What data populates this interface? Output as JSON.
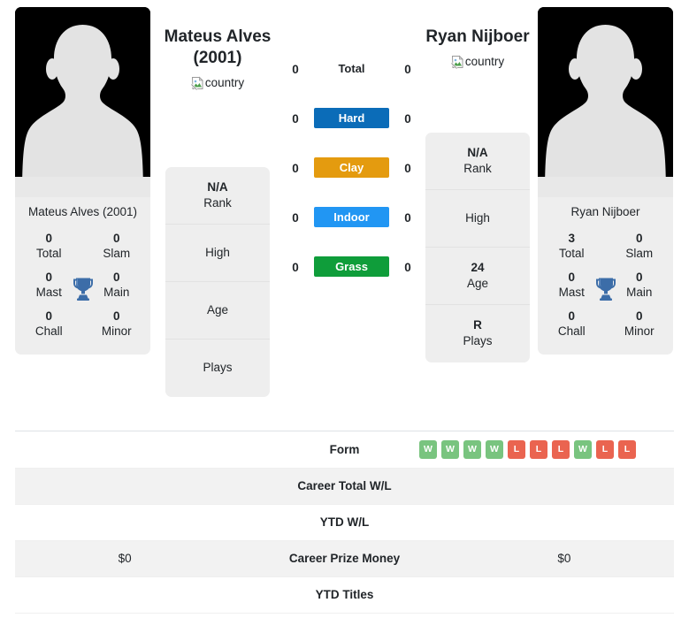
{
  "players": {
    "left": {
      "heading": "Mateus Alves (2001)",
      "card_name": "Mateus Alves (2001)",
      "country_alt": "country",
      "photo_alt": "player-photo",
      "titles": [
        {
          "num": "0",
          "label": "Total"
        },
        {
          "num": "0",
          "label": "Slam"
        },
        {
          "num": "0",
          "label": "Mast"
        },
        {
          "num": "0",
          "label": "Main"
        },
        {
          "num": "0",
          "label": "Chall"
        },
        {
          "num": "0",
          "label": "Minor"
        }
      ],
      "info": [
        {
          "value": "N/A",
          "caption": "Rank"
        },
        {
          "value": "",
          "caption": "High"
        },
        {
          "value": "",
          "caption": "Age"
        },
        {
          "value": "",
          "caption": "Plays"
        }
      ]
    },
    "right": {
      "heading": "Ryan Nijboer",
      "card_name": "Ryan Nijboer",
      "country_alt": "country",
      "photo_alt": "player-photo",
      "titles": [
        {
          "num": "3",
          "label": "Total"
        },
        {
          "num": "0",
          "label": "Slam"
        },
        {
          "num": "0",
          "label": "Mast"
        },
        {
          "num": "0",
          "label": "Main"
        },
        {
          "num": "0",
          "label": "Chall"
        },
        {
          "num": "0",
          "label": "Minor"
        }
      ],
      "info": [
        {
          "value": "N/A",
          "caption": "Rank"
        },
        {
          "value": "",
          "caption": "High"
        },
        {
          "value": "24",
          "caption": "Age"
        },
        {
          "value": "R",
          "caption": "Plays"
        }
      ]
    }
  },
  "surfaces": [
    {
      "label": "Total",
      "left": "0",
      "right": "0",
      "color": "",
      "style": "plain"
    },
    {
      "label": "Hard",
      "left": "0",
      "right": "0",
      "color": "#0b6cb8",
      "style": "pill"
    },
    {
      "label": "Clay",
      "left": "0",
      "right": "0",
      "color": "#e49b0f",
      "style": "pill"
    },
    {
      "label": "Indoor",
      "left": "0",
      "right": "0",
      "color": "#2196f3",
      "style": "pill"
    },
    {
      "label": "Grass",
      "left": "0",
      "right": "0",
      "color": "#0f9d3a",
      "style": "pill"
    }
  ],
  "comparison_rows": [
    {
      "left": "",
      "label": "Form",
      "right": ""
    },
    {
      "left": "",
      "label": "Career Total W/L",
      "right": ""
    },
    {
      "left": "",
      "label": "YTD W/L",
      "right": ""
    },
    {
      "left": "$0",
      "label": "Career Prize Money",
      "right": "$0"
    },
    {
      "left": "",
      "label": "YTD Titles",
      "right": ""
    }
  ],
  "form": {
    "results": [
      "W",
      "W",
      "W",
      "W",
      "L",
      "L",
      "L",
      "W",
      "L",
      "L"
    ],
    "win_color": "#79c47f",
    "loss_color": "#ea6450"
  },
  "colors": {
    "trophy": "#3c6da8",
    "card_bg": "#eeeeee",
    "photo_bg": "#000000",
    "silhouette": "#e3e3e3"
  }
}
